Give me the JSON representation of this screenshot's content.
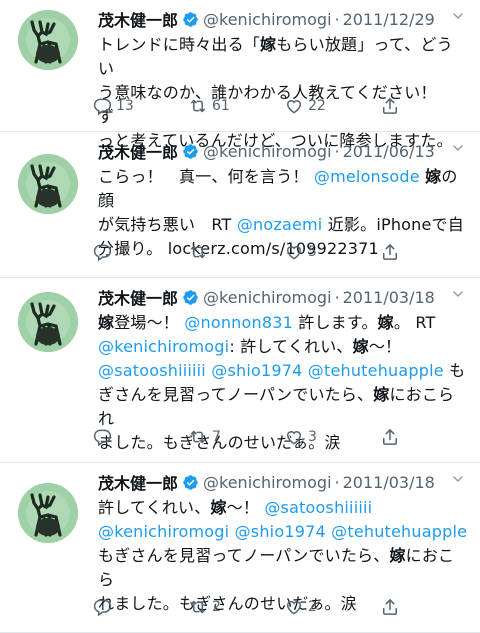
{
  "tweets": [
    {
      "name": "茂木健一郎",
      "handle": "@kenichiromogi",
      "date": "2011/12/29",
      "lines": [
        [
          {
            "t": "トレンドに時々出る「"
          },
          {
            "t": "嫁",
            "b": true
          },
          {
            "t": "もらい放題」って、どうい"
          }
        ],
        [
          {
            "t": "う意味なのか、誰かわかる人教えてください！　ず"
          }
        ],
        [
          {
            "t": "っと考えているんだけど、ついに降参しますた。"
          }
        ]
      ],
      "reply_count": "13",
      "retweet_count": "61",
      "like_count": "22"
    },
    {
      "name": "茂木健一郎",
      "handle": "@kenichiromogi",
      "date": "2011/06/13",
      "lines": [
        [
          {
            "t": "こらっ！　真一、何を言う！ "
          },
          {
            "t": "@melonsode",
            "l": true
          },
          {
            "t": " "
          },
          {
            "t": "嫁",
            "b": true
          },
          {
            "t": "の顔"
          }
        ],
        [
          {
            "t": "が気持ち悪い　RT "
          },
          {
            "t": "@nozaemi",
            "l": true
          },
          {
            "t": " 近影。iPhoneで自"
          }
        ],
        [
          {
            "t": "分撮り。 lockerz.com/s/109922371"
          }
        ]
      ],
      "reply_count": "",
      "retweet_count": "",
      "like_count": "5"
    },
    {
      "name": "茂木健一郎",
      "handle": "@kenichiromogi",
      "date": "2011/03/18",
      "lines": [
        [
          {
            "t": "嫁",
            "b": true
          },
          {
            "t": "登場〜！ "
          },
          {
            "t": "@nonnon831",
            "l": true
          },
          {
            "t": " 許します。"
          },
          {
            "t": "嫁",
            "b": true
          },
          {
            "t": "。 RT"
          }
        ],
        [
          {
            "t": "@kenichiromogi",
            "l": true
          },
          {
            "t": ": 許してくれい、"
          },
          {
            "t": "嫁",
            "b": true
          },
          {
            "t": "〜！"
          }
        ],
        [
          {
            "t": "@satooshiiiiii",
            "l": true
          },
          {
            "t": " "
          },
          {
            "t": "@shio1974",
            "l": true
          },
          {
            "t": " "
          },
          {
            "t": "@tehutehuapple",
            "l": true
          },
          {
            "t": " も"
          }
        ],
        [
          {
            "t": "ぎさんを見習ってノーパンでいたら、"
          },
          {
            "t": "嫁",
            "b": true
          },
          {
            "t": "におこられ"
          }
        ],
        [
          {
            "t": "ました。もぎさんのせいだぁ。涙"
          }
        ]
      ],
      "reply_count": "",
      "retweet_count": "7",
      "like_count": "3"
    },
    {
      "name": "茂木健一郎",
      "handle": "@kenichiromogi",
      "date": "2011/03/18",
      "lines": [
        [
          {
            "t": "許してくれい、"
          },
          {
            "t": "嫁",
            "b": true
          },
          {
            "t": "〜！ "
          },
          {
            "t": "@satooshiiiiii",
            "l": true
          }
        ],
        [
          {
            "t": "@kenichiromogi",
            "l": true
          },
          {
            "t": " "
          },
          {
            "t": "@shio1974",
            "l": true
          },
          {
            "t": " "
          },
          {
            "t": "@tehutehuapple",
            "l": true
          }
        ],
        [
          {
            "t": "もぎさんを見習ってノーパンでいたら、"
          },
          {
            "t": "嫁",
            "b": true
          },
          {
            "t": "におこら"
          }
        ],
        [
          {
            "t": "れました。もぎさんのせいだぁ。涙"
          }
        ]
      ],
      "reply_count": "",
      "retweet_count": "2",
      "like_count": "2"
    }
  ],
  "icons": {
    "verified": "verified-badge-icon",
    "reply": "reply-icon",
    "retweet": "retweet-icon",
    "like": "heart-icon",
    "share": "share-icon",
    "more": "chevron-down-icon"
  },
  "colors": {
    "link": "#1d9bf0",
    "meta": "#536471",
    "verified": "#1d9bf0",
    "divider": "#e1e6ea"
  }
}
